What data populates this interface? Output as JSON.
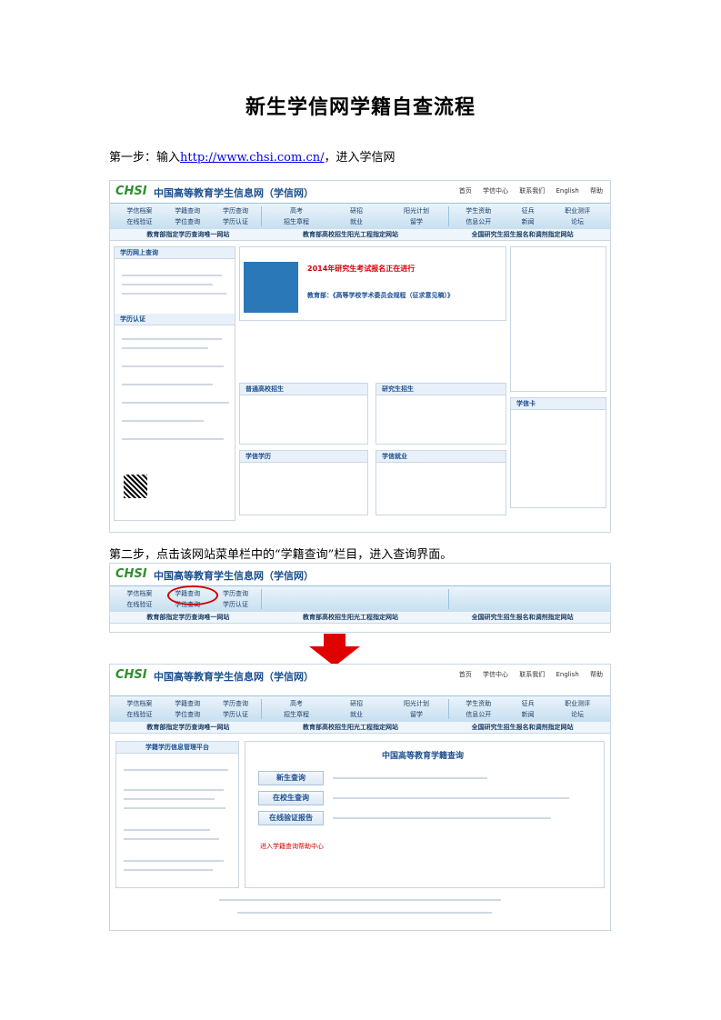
{
  "page": {
    "title": "新生学信网学籍自查流程",
    "step1_prefix": "第一步：输入",
    "step1_link": "http://www.chsi.com.cn/",
    "step1_suffix": "，进入学信网",
    "step2": "第二步，点击该网站菜单栏中的“学籍查询”栏目，进入查询界面。"
  },
  "site": {
    "logo": "CHSI",
    "name": "中国高等教育学生信息网（学信网）",
    "toplinks": [
      "首页",
      "学信中心",
      "联系我们",
      "English",
      "帮助"
    ],
    "nav_groups": [
      [
        "学信档案",
        "学籍查询",
        "学历查询",
        "在线验证",
        "学位查询",
        "学历认证"
      ],
      [
        "高考",
        "研招",
        "阳光计划",
        "招生章程",
        "就业",
        "留学"
      ],
      [
        "学生资助",
        "征兵",
        "职业测评",
        "信息公开",
        "新闻",
        "论坛"
      ]
    ],
    "subnav": [
      "教育部指定学历查询唯一网站",
      "教育部高校招生阳光工程指定网站",
      "全国研究生招生报名和调剂指定网站"
    ],
    "news_headline": "2014年研究生考试报名正在进行",
    "news_sub": "教育部：《高等学校学术委员会规程（征求意见稿）》",
    "sections": [
      "普通高校招生",
      "研究生招生",
      "学信学历",
      "学信就业",
      "学历网上查询",
      "学历认证",
      "学信卡"
    ],
    "query_page_title": "中国高等教育学籍查询",
    "query_buttons": [
      "新生查询",
      "在校生查询",
      "在线验证报告"
    ],
    "query_left_title": "学籍学历信息管理平台",
    "query_note": "进入学籍查询帮助中心"
  },
  "colors": {
    "accent": "#1c4f8f",
    "arrow": "#e00000",
    "highlight": "#d10000"
  }
}
